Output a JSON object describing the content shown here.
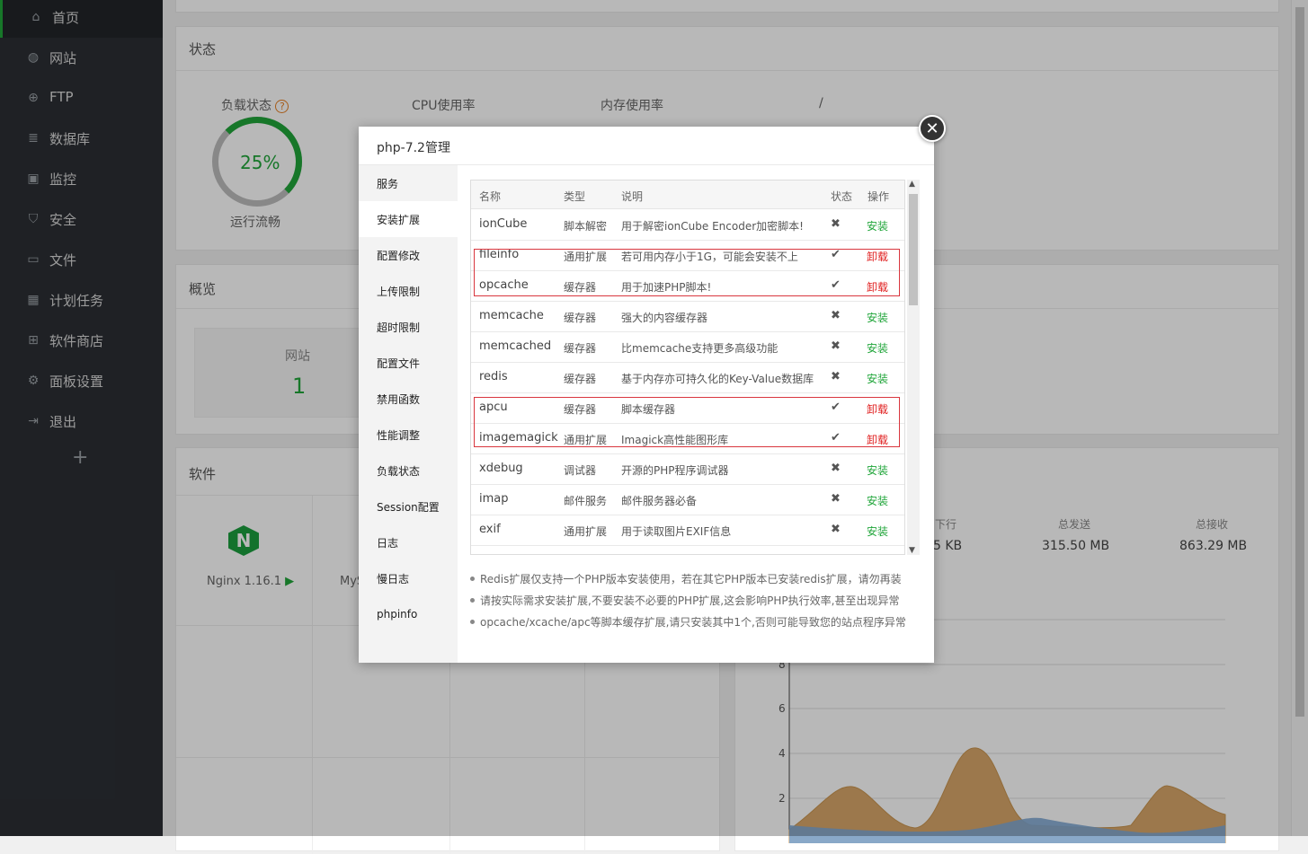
{
  "sidebar": {
    "items": [
      {
        "label": "首页",
        "icon": "home-icon"
      },
      {
        "label": "网站",
        "icon": "globe-icon"
      },
      {
        "label": "FTP",
        "icon": "ftp-icon"
      },
      {
        "label": "数据库",
        "icon": "database-icon"
      },
      {
        "label": "监控",
        "icon": "monitor-icon"
      },
      {
        "label": "安全",
        "icon": "shield-icon"
      },
      {
        "label": "文件",
        "icon": "folder-icon"
      },
      {
        "label": "计划任务",
        "icon": "calendar-icon"
      },
      {
        "label": "软件商店",
        "icon": "apps-icon"
      },
      {
        "label": "面板设置",
        "icon": "gear-icon"
      },
      {
        "label": "退出",
        "icon": "logout-icon"
      }
    ],
    "add_label": "+"
  },
  "status_panel": {
    "title": "状态",
    "gauges": [
      {
        "label": "负载状态",
        "value": "25%",
        "sub": "运行流畅"
      },
      {
        "label": "CPU使用率"
      },
      {
        "label": "内存使用率"
      },
      {
        "label": "/"
      }
    ]
  },
  "overview_panel": {
    "title": "概览",
    "site_label": "网站",
    "site_count": "1"
  },
  "software_panel": {
    "title": "软件",
    "nginx_label": "Nginx 1.16.1",
    "partial_label": "MyS"
  },
  "traffic_panel": {
    "partial_down": "下行",
    "partial_down_val": "5 KB",
    "total_sent_label": "总发送",
    "total_sent": "315.50 MB",
    "total_recv_label": "总接收",
    "total_recv": "863.29 MB",
    "y_ticks": [
      "8",
      "6",
      "4",
      "2"
    ]
  },
  "modal": {
    "title": "php-7.2管理",
    "close_label": "✕",
    "menu": [
      "服务",
      "安装扩展",
      "配置修改",
      "上传限制",
      "超时限制",
      "配置文件",
      "禁用函数",
      "性能调整",
      "负载状态",
      "Session配置",
      "日志",
      "慢日志",
      "phpinfo"
    ],
    "active_menu": "安装扩展",
    "table": {
      "headers": [
        "名称",
        "类型",
        "说明",
        "状态",
        "操作"
      ],
      "rows": [
        {
          "name": "ionCube",
          "type": "脚本解密",
          "desc": "用于解密ionCube Encoder加密脚本!",
          "status": "✖",
          "action": "安装"
        },
        {
          "name": "fileinfo",
          "type": "通用扩展",
          "desc": "若可用内存小于1G，可能会安装不上",
          "status": "✔",
          "action": "卸载"
        },
        {
          "name": "opcache",
          "type": "缓存器",
          "desc": "用于加速PHP脚本!",
          "status": "✔",
          "action": "卸载"
        },
        {
          "name": "memcache",
          "type": "缓存器",
          "desc": "强大的内容缓存器",
          "status": "✖",
          "action": "安装"
        },
        {
          "name": "memcached",
          "type": "缓存器",
          "desc": "比memcache支持更多高级功能",
          "status": "✖",
          "action": "安装"
        },
        {
          "name": "redis",
          "type": "缓存器",
          "desc": "基于内存亦可持久化的Key-Value数据库",
          "status": "✖",
          "action": "安装"
        },
        {
          "name": "apcu",
          "type": "缓存器",
          "desc": "脚本缓存器",
          "status": "✔",
          "action": "卸载"
        },
        {
          "name": "imagemagick",
          "type": "通用扩展",
          "desc": "Imagick高性能图形库",
          "status": "✔",
          "action": "卸载"
        },
        {
          "name": "xdebug",
          "type": "调试器",
          "desc": "开源的PHP程序调试器",
          "status": "✖",
          "action": "安装"
        },
        {
          "name": "imap",
          "type": "邮件服务",
          "desc": "邮件服务器必备",
          "status": "✖",
          "action": "安装"
        },
        {
          "name": "exif",
          "type": "通用扩展",
          "desc": "用于读取图片EXIF信息",
          "status": "✖",
          "action": "安装"
        }
      ]
    },
    "notes": [
      "Redis扩展仅支持一个PHP版本安装使用，若在其它PHP版本已安装redis扩展，请勿再装",
      "请按实际需求安装扩展,不要安装不必要的PHP扩展,这会影响PHP执行效率,甚至出现异常",
      "opcache/xcache/apc等脚本缓存扩展,请只安装其中1个,否则可能导致您的站点程序异常"
    ]
  },
  "colors": {
    "accent": "#20a53a",
    "danger": "#e02020",
    "sidebar_bg": "#2b2f34"
  }
}
